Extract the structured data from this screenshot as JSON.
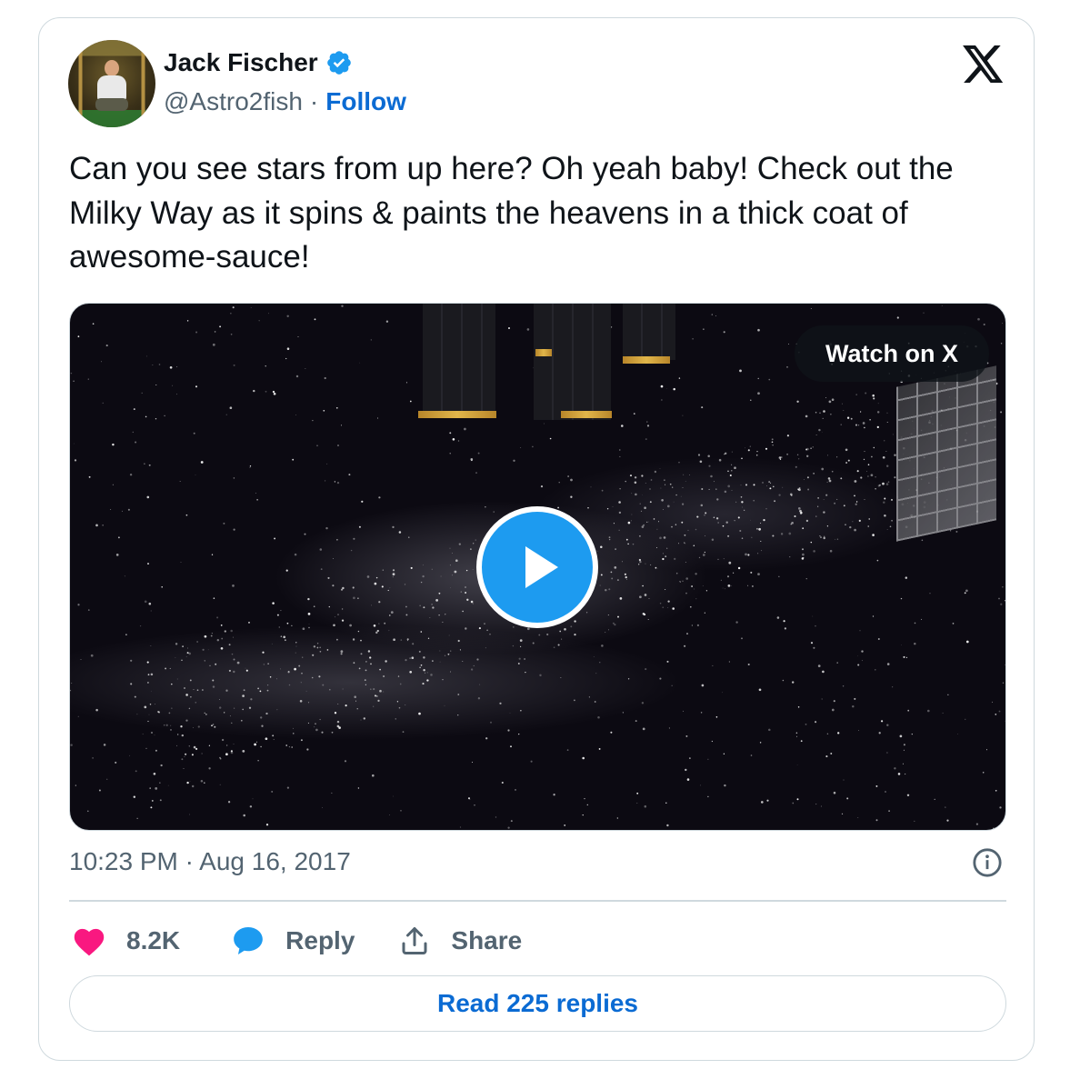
{
  "author": {
    "name": "Jack Fischer",
    "handle": "@Astro2fish",
    "separator": "·",
    "follow_label": "Follow"
  },
  "tweet": {
    "text": "Can you see stars from up here? Oh yeah baby! Check out the Milky Way as it spins & paints the heavens in a thick coat of awesome-sauce!",
    "timestamp": "10:23 PM · Aug 16, 2017"
  },
  "media": {
    "watch_label": "Watch on X"
  },
  "actions": {
    "like_count": "8.2K",
    "reply_label": "Reply",
    "share_label": "Share"
  },
  "read_replies_label": "Read 225 replies",
  "colors": {
    "accent": "#1d9bf0",
    "link": "#0b6bd3",
    "like": "#f91880",
    "border": "#cfd9de",
    "secondary_text": "#536471"
  },
  "icons": {
    "verified": "verified-badge-icon",
    "brand": "x-logo-icon",
    "play": "play-icon",
    "info": "info-icon",
    "like": "heart-icon",
    "reply": "speech-bubble-icon",
    "share": "share-upload-icon"
  }
}
